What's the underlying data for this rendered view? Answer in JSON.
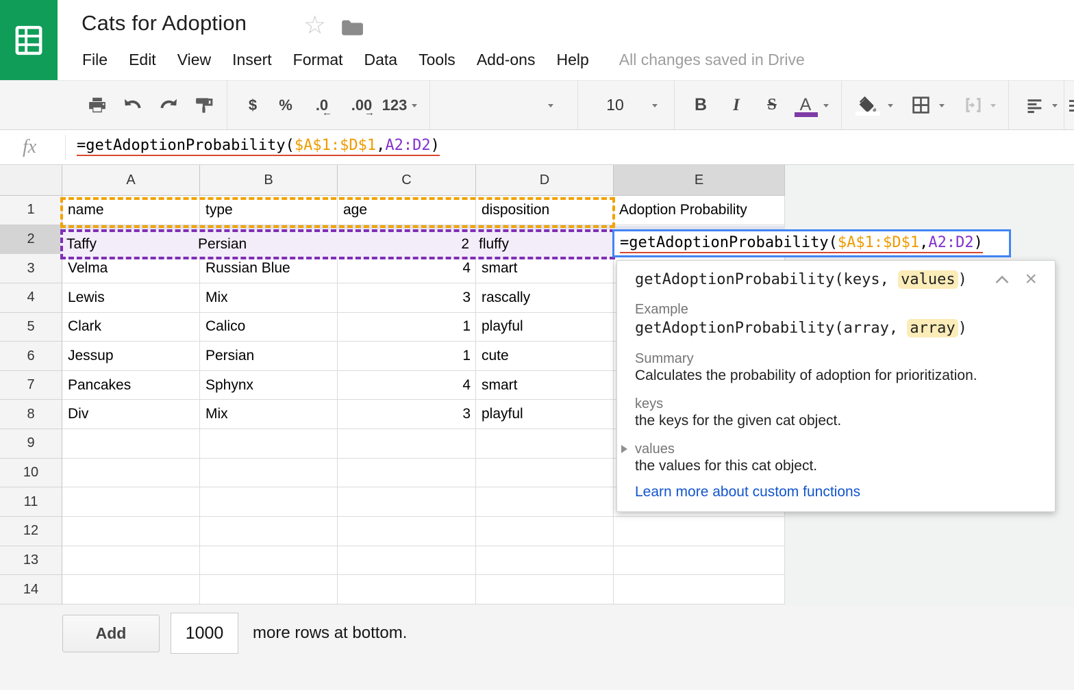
{
  "header": {
    "title": "Cats for Adoption",
    "save_status": "All changes saved in Drive",
    "menu": {
      "file": "File",
      "edit": "Edit",
      "view": "View",
      "insert": "Insert",
      "format": "Format",
      "data": "Data",
      "tools": "Tools",
      "addons": "Add-ons",
      "help": "Help"
    }
  },
  "toolbar": {
    "currency": "$",
    "percent": "%",
    "decimal_decrease": ".0",
    "decimal_increase": ".00",
    "more_formats": "123",
    "font_size": "10",
    "bold": "B",
    "italic": "I",
    "strikethrough": "S",
    "text_color": "A"
  },
  "formula_bar": {
    "fx_label": "fx"
  },
  "formula": {
    "prefix": "=getAdoptionProbability(",
    "range1": "$A$1:$D$1",
    "comma": ",",
    "range2": "A2:D2",
    "suffix": ")"
  },
  "grid": {
    "columns": [
      "A",
      "B",
      "C",
      "D",
      "E"
    ],
    "row_numbers": [
      "1",
      "2",
      "3",
      "4",
      "5",
      "6",
      "7",
      "8",
      "9",
      "10",
      "11",
      "12",
      "13",
      "14"
    ],
    "header_row": [
      "name",
      "type",
      "age",
      "disposition",
      "Adoption Probability"
    ],
    "rows": [
      {
        "name": "Taffy",
        "type": "Persian",
        "age": "2",
        "disposition": "fluffy"
      },
      {
        "name": "Velma",
        "type": "Russian Blue",
        "age": "4",
        "disposition": "smart"
      },
      {
        "name": "Lewis",
        "type": "Mix",
        "age": "3",
        "disposition": "rascally"
      },
      {
        "name": "Clark",
        "type": "Calico",
        "age": "1",
        "disposition": "playful"
      },
      {
        "name": "Jessup",
        "type": "Persian",
        "age": "1",
        "disposition": "cute"
      },
      {
        "name": "Pancakes",
        "type": "Sphynx",
        "age": "4",
        "disposition": "smart"
      },
      {
        "name": "Div",
        "type": "Mix",
        "age": "3",
        "disposition": "playful"
      }
    ]
  },
  "tooltip": {
    "signature_pre": "getAdoptionProbability(keys, ",
    "signature_highlight": "values",
    "signature_post": ")",
    "example_label": "Example",
    "example_pre": "getAdoptionProbability(array, ",
    "example_highlight": "array",
    "example_post": ")",
    "summary_label": "Summary",
    "summary_text": "Calculates the probability of adoption for prioritization.",
    "param1_label": "keys",
    "param1_desc": "the keys for the given cat object.",
    "param2_label": "values",
    "param2_desc": "the values for this cat object.",
    "learn_more": "Learn more about custom functions",
    "close_glyph": "×"
  },
  "footer": {
    "add_label": "Add",
    "rows_value": "1000",
    "suffix_text": "more rows at bottom."
  },
  "colors": {
    "logo_green": "#0f9d58",
    "reference_orange": "#f2a202",
    "reference_purple": "#7e2fb5",
    "active_cell_blue": "#4285f4",
    "formula_range1_orange": "#ee9b00",
    "formula_range2_purple": "#8430ce",
    "param_highlight_yellow": "#fbecb8",
    "link_blue": "#1155cc",
    "text_color_indicator": "#7e3ba5",
    "row2_fill": "#f3edf9"
  }
}
